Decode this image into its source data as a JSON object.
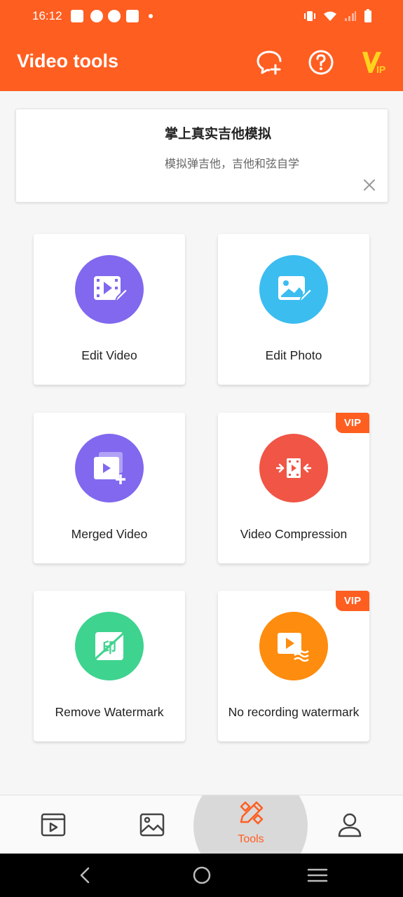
{
  "status_bar": {
    "time": "16:12",
    "icons": [
      "mail-icon",
      "gauge-icon",
      "gauge-icon",
      "mail-icon",
      "dot-icon",
      "vibrate-icon",
      "wifi-icon",
      "signal-icon",
      "battery-icon"
    ]
  },
  "app_bar": {
    "title": "Video tools",
    "icons": [
      "add-chat-icon",
      "help-icon",
      "vip-icon"
    ],
    "vip_text": "IP"
  },
  "ad": {
    "title": "掌上真实吉他模拟",
    "subtitle": "模拟弹吉他，吉他和弦自学"
  },
  "tools": [
    {
      "label": "Edit Video",
      "icon": "edit-video-icon",
      "color": "#8168ee",
      "vip": false
    },
    {
      "label": "Edit Photo",
      "icon": "edit-photo-icon",
      "color": "#3bbdf0",
      "vip": false
    },
    {
      "label": "Merged Video",
      "icon": "merge-video-icon",
      "color": "#8168ee",
      "vip": false
    },
    {
      "label": "Video Compression",
      "icon": "compress-video-icon",
      "color": "#f05545",
      "vip": true,
      "vip_label": "VIP"
    },
    {
      "label": "Remove Watermark",
      "icon": "remove-watermark-icon",
      "color": "#3ed38f",
      "vip": false
    },
    {
      "label": "No recording watermark",
      "icon": "no-watermark-icon",
      "color": "#fe8c0e",
      "vip": true,
      "vip_label": "VIP"
    }
  ],
  "bottom_nav": {
    "items": [
      {
        "name": "videos",
        "icon": "video-list-icon"
      },
      {
        "name": "photos",
        "icon": "image-icon"
      },
      {
        "name": "tools",
        "icon": "tools-icon",
        "label": "Tools",
        "active": true
      },
      {
        "name": "profile",
        "icon": "person-icon"
      }
    ]
  },
  "system_nav": [
    "back-icon",
    "home-icon",
    "recents-icon"
  ],
  "colors": {
    "accent": "#ff5e21",
    "background": "#f6f6f6"
  }
}
